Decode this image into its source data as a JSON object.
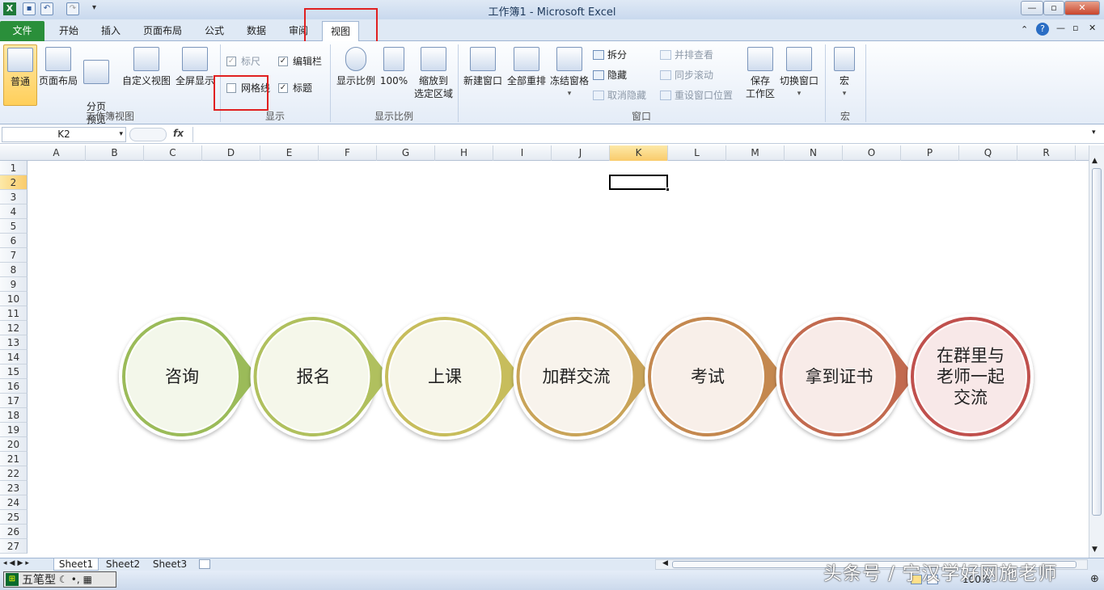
{
  "window": {
    "title": "工作簿1 - Microsoft Excel"
  },
  "tabs": [
    "文件",
    "开始",
    "插入",
    "页面布局",
    "公式",
    "数据",
    "审阅",
    "视图"
  ],
  "ribbon": {
    "views": {
      "normal": "普通",
      "page_layout": "页面布局",
      "page_break": "分页\n预览",
      "custom": "自定义视图",
      "fullscreen": "全屏显示",
      "label": "工作簿视图"
    },
    "show": {
      "ruler": "标尺",
      "gridlines": "网格线",
      "formula_bar": "编辑栏",
      "headings": "标题",
      "label": "显示"
    },
    "zoom": {
      "zoom": "显示比例",
      "hundred": "100%",
      "to_selection_1": "缩放到",
      "to_selection_2": "选定区域",
      "label": "显示比例"
    },
    "window": {
      "new": "新建窗口",
      "arrange": "全部重排",
      "freeze": "冻结窗格",
      "split": "拆分",
      "hide": "隐藏",
      "unhide": "取消隐藏",
      "side_by_side": "并排查看",
      "sync_scroll": "同步滚动",
      "reset_pos": "重设窗口位置",
      "save_ws_1": "保存",
      "save_ws_2": "工作区",
      "switch": "切换窗口",
      "label": "窗口"
    },
    "macros": {
      "macro": "宏",
      "label": "宏"
    }
  },
  "formula_bar": {
    "name_box": "K2",
    "fx": "fx",
    "value": ""
  },
  "columns": [
    "A",
    "B",
    "C",
    "D",
    "E",
    "F",
    "G",
    "H",
    "I",
    "J",
    "K",
    "L",
    "M",
    "N",
    "O",
    "P",
    "Q",
    "R"
  ],
  "rows": [
    "1",
    "2",
    "3",
    "4",
    "5",
    "6",
    "7",
    "8",
    "9",
    "10",
    "11",
    "12",
    "13",
    "14",
    "15",
    "16",
    "17",
    "18",
    "19",
    "20",
    "21",
    "22",
    "23",
    "24",
    "25",
    "26",
    "27"
  ],
  "selected_cell": "K2",
  "flow": {
    "steps": [
      "咨询",
      "报名",
      "上课",
      "加群交流",
      "考试",
      "拿到证书",
      "在群里与老师一起交流"
    ]
  },
  "sheets": [
    "Sheet1",
    "Sheet2",
    "Sheet3"
  ],
  "status": {
    "ime": "五笔型",
    "zoom": "100%"
  },
  "watermark": "头条号 / 宁汉学好网施老师",
  "colors": {
    "step_colors": [
      "#9bbb59",
      "#b0c05e",
      "#c7bd5c",
      "#c9a459",
      "#c4884f",
      "#c26a4f",
      "#c0504d"
    ],
    "file_tab": "#2a8f3a",
    "highlight": "#e02020"
  }
}
